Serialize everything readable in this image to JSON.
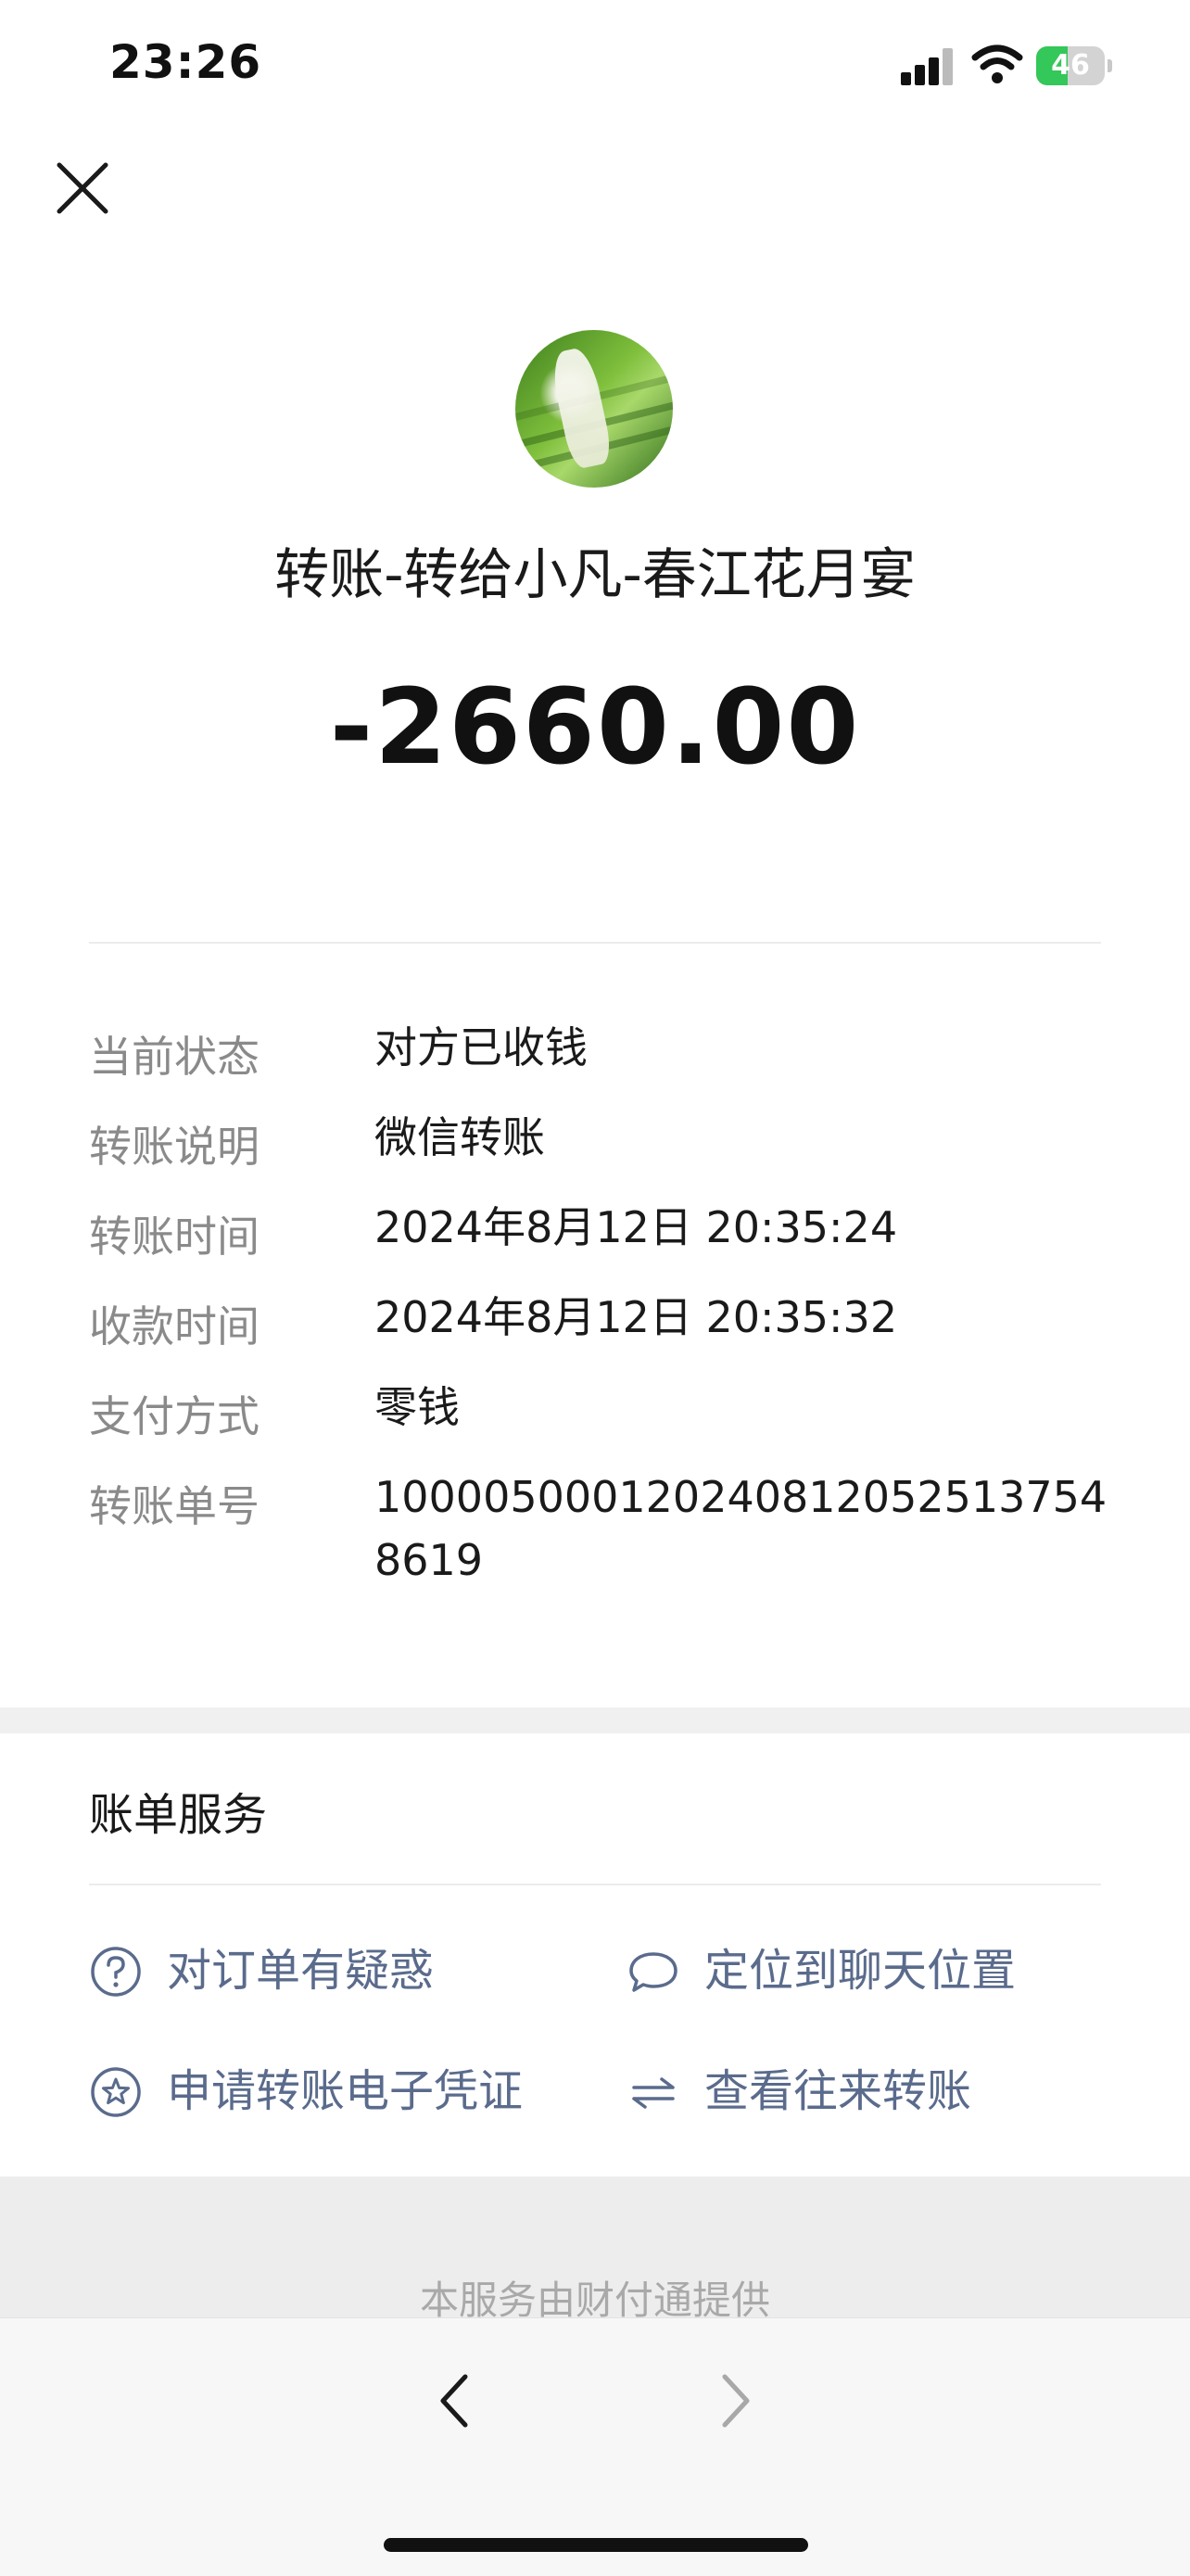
{
  "status_bar": {
    "time": "23:26",
    "battery": "46",
    "battery_level_percent": 46,
    "signal_icon": "signal-icon",
    "wifi_icon": "wifi-icon"
  },
  "header": {
    "close_icon": "close-icon"
  },
  "transfer": {
    "title": "转账-转给小凡-春江花月宴",
    "amount": "-2660.00"
  },
  "details": [
    {
      "label": "当前状态",
      "value": "对方已收钱"
    },
    {
      "label": "转账说明",
      "value": "微信转账"
    },
    {
      "label": "转账时间",
      "value": "2024年8月12日 20:35:24"
    },
    {
      "label": "收款时间",
      "value": "2024年8月12日 20:35:32"
    },
    {
      "label": "支付方式",
      "value": "零钱"
    },
    {
      "label": "转账单号",
      "value": "100005000120240812052513754 8619"
    }
  ],
  "bill_services": {
    "title": "账单服务",
    "items": [
      {
        "label": "对订单有疑惑",
        "icon": "question-circle-icon"
      },
      {
        "label": "定位到聊天位置",
        "icon": "chat-bubble-icon"
      },
      {
        "label": "申请转账电子凭证",
        "icon": "star-circle-icon"
      },
      {
        "label": "查看往来转账",
        "icon": "swap-arrows-icon"
      }
    ]
  },
  "footer": {
    "provider_text": "本服务由财付通提供"
  },
  "browser_nav": {
    "back_icon": "chevron-left-icon",
    "forward_icon": "chevron-right-icon"
  },
  "colors": {
    "link": "#5a6b8c",
    "label_gray": "#8a8a8a",
    "battery_green": "#34c759"
  }
}
